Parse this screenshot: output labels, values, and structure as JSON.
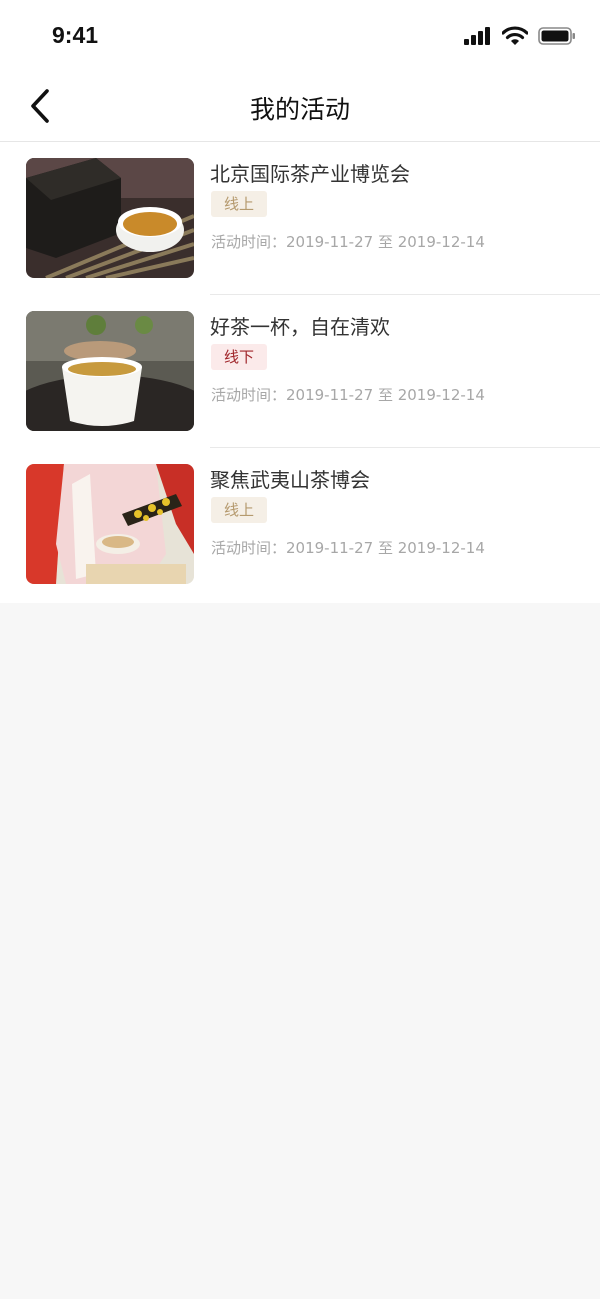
{
  "status_bar": {
    "time": "9:41"
  },
  "nav": {
    "title": "我的活动"
  },
  "activities": [
    {
      "title": "北京国际茶产业博览会",
      "tag": "线上",
      "time": "活动时间：2019-11-27 至 2019-12-14"
    },
    {
      "title": "好茶一杯，自在清欢",
      "tag": "线下",
      "time": "活动时间：2019-11-27 至 2019-12-14"
    },
    {
      "title": "聚焦武夷山茶博会",
      "tag": "线上",
      "time": "活动时间：2019-11-27 至 2019-12-14"
    }
  ],
  "colors": {
    "online_tag_bg": "#f5efe6",
    "online_tag_text": "#b59a6e",
    "offline_tag_bg": "#fbeaea",
    "offline_tag_text": "#a0262b",
    "page_bg": "#f7f7f7"
  },
  "icons": [
    "signal-icon",
    "wifi-icon",
    "battery-icon",
    "back-arrow-icon"
  ]
}
